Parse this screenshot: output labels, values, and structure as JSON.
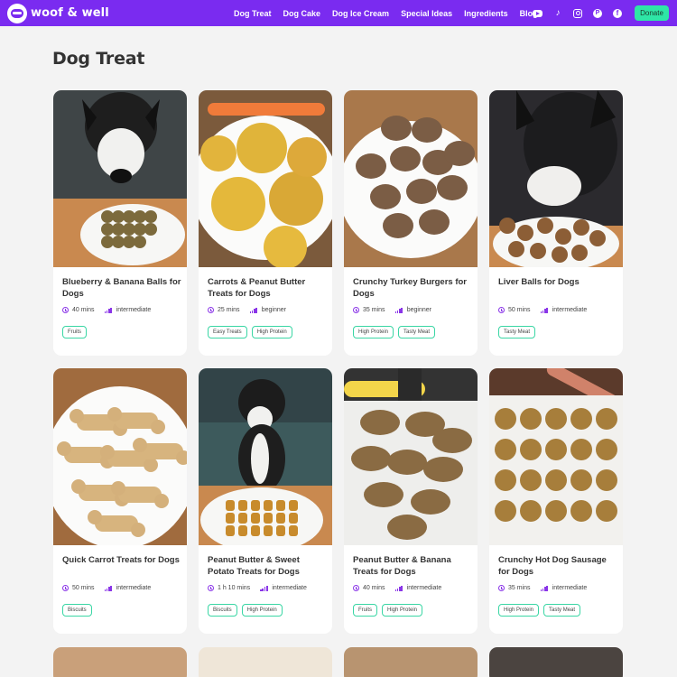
{
  "brand": {
    "name": "woof & well"
  },
  "nav": [
    "Dog Treat",
    "Dog Cake",
    "Dog Ice Cream",
    "Special Ideas",
    "Ingredients",
    "Blog"
  ],
  "social_icons": [
    "youtube-icon",
    "tiktok-icon",
    "instagram-icon",
    "pinterest-icon",
    "facebook-icon"
  ],
  "donate_label": "Donate",
  "page_title": "Dog Treat",
  "colors": {
    "header": "#7a2bf0",
    "accent": "#8a35e8",
    "tag_border": "#3ad6a4",
    "donate": "#2ee6a6"
  },
  "cards": [
    {
      "title": "Blueberry & Banana Balls for Dogs",
      "time": "40 mins",
      "level": "intermediate",
      "tags": [
        "Fruits"
      ]
    },
    {
      "title": "Carrots & Peanut Butter Treats for Dogs",
      "time": "25 mins",
      "level": "beginner",
      "tags": [
        "Easy Treats",
        "High Protein"
      ]
    },
    {
      "title": "Crunchy Turkey Burgers for Dogs",
      "time": "35 mins",
      "level": "beginner",
      "tags": [
        "High Protein",
        "Tasty Meat"
      ]
    },
    {
      "title": "Liver Balls for Dogs",
      "time": "50 mins",
      "level": "intermediate",
      "tags": [
        "Tasty Meat"
      ]
    },
    {
      "title": "Quick Carrot Treats for Dogs",
      "time": "50 mins",
      "level": "intermediate",
      "tags": [
        "Biscuits"
      ]
    },
    {
      "title": "Peanut Butter & Sweet Potato Treats for Dogs",
      "time": "1 h 10 mins",
      "level": "intermediate",
      "tags": [
        "Biscuits",
        "High Protein"
      ]
    },
    {
      "title": "Peanut Butter & Banana Treats for Dogs",
      "time": "40 mins",
      "level": "intermediate",
      "tags": [
        "Fruits",
        "High Protein"
      ]
    },
    {
      "title": "Crunchy Hot Dog Sausage for Dogs",
      "time": "35 mins",
      "level": "intermediate",
      "tags": [
        "High Protein",
        "Tasty Meat"
      ]
    }
  ]
}
